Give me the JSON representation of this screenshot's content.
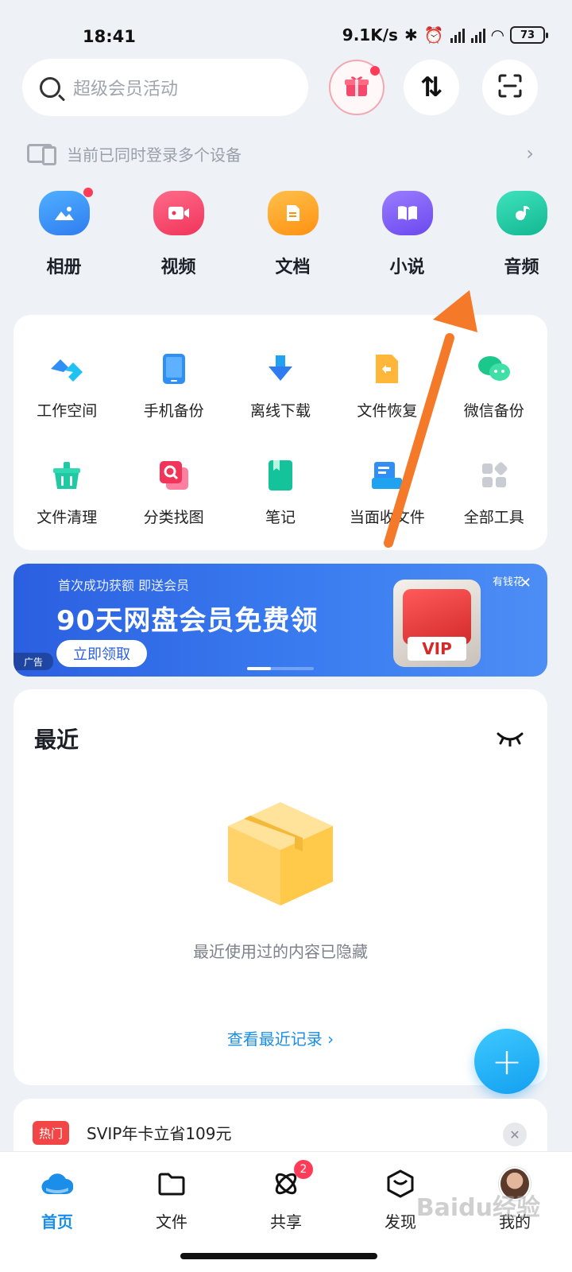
{
  "status_bar": {
    "time": "18:41",
    "network_speed": "9.1K/s",
    "battery": "73"
  },
  "search": {
    "placeholder": "超级会员活动"
  },
  "header_icons": [
    "gift-icon",
    "sort-icon",
    "scan-icon"
  ],
  "device_notice": {
    "text": "当前已同时登录多个设备"
  },
  "categories": [
    {
      "label": "相册",
      "icon": "album-icon",
      "color": "#2f8ff5"
    },
    {
      "label": "视频",
      "icon": "video-icon",
      "color": "#f5486b"
    },
    {
      "label": "文档",
      "icon": "document-icon",
      "color": "#ffa322"
    },
    {
      "label": "小说",
      "icon": "novel-icon",
      "color": "#7a5cf0"
    },
    {
      "label": "音频",
      "icon": "audio-icon",
      "color": "#1ec9a4"
    }
  ],
  "tools": [
    {
      "label": "工作空间",
      "icon": "workspace-icon"
    },
    {
      "label": "手机备份",
      "icon": "phone-backup-icon"
    },
    {
      "label": "离线下载",
      "icon": "offline-download-icon"
    },
    {
      "label": "文件恢复",
      "icon": "file-restore-icon"
    },
    {
      "label": "微信备份",
      "icon": "wechat-backup-icon"
    },
    {
      "label": "文件清理",
      "icon": "file-clean-icon"
    },
    {
      "label": "分类找图",
      "icon": "image-search-icon"
    },
    {
      "label": "笔记",
      "icon": "notes-icon"
    },
    {
      "label": "当面收文件",
      "icon": "receive-file-icon"
    },
    {
      "label": "全部工具",
      "icon": "all-tools-icon"
    }
  ],
  "banner": {
    "subtitle": "首次成功获额 即送会员",
    "title": "90天网盘会员免费领",
    "button": "立即领取",
    "ad_tag": "广告",
    "brand": "有钱花",
    "vip_text": "VIP"
  },
  "recent": {
    "title": "最近",
    "empty_text": "最近使用过的内容已隐藏",
    "link": "查看最近记录 ›"
  },
  "promo": {
    "tag": "热门",
    "text": "SVIP年卡立省109元"
  },
  "tabs": [
    {
      "label": "首页",
      "icon": "home-cloud-icon",
      "active": true
    },
    {
      "label": "文件",
      "icon": "folder-icon"
    },
    {
      "label": "共享",
      "icon": "share-icon",
      "badge": "2"
    },
    {
      "label": "发现",
      "icon": "discover-icon"
    },
    {
      "label": "我的",
      "icon": "avatar"
    }
  ],
  "watermark": "Baidu经验",
  "colors": {
    "accent": "#1a8ee8",
    "arrow": "#f47a2a",
    "badge": "#ff3b57"
  }
}
